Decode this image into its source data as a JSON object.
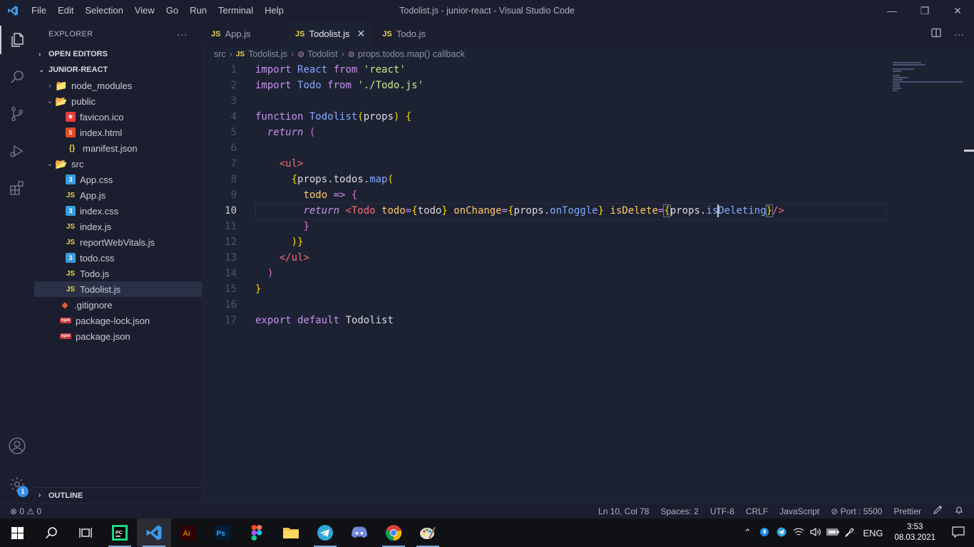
{
  "window": {
    "title": "Todolist.js - junior-react - Visual Studio Code",
    "menu": [
      "File",
      "Edit",
      "Selection",
      "View",
      "Go",
      "Run",
      "Terminal",
      "Help"
    ],
    "controls": {
      "minimize": "—",
      "restore": "❐",
      "close": "✕"
    }
  },
  "activity": {
    "settings_badge": "1"
  },
  "sidebar": {
    "header": "EXPLORER",
    "more": "···",
    "open_editors": "OPEN EDITORS",
    "project": "JUNIOR-REACT",
    "outline": "OUTLINE",
    "tree": [
      {
        "label": "node_modules",
        "type": "folder",
        "depth": 1,
        "chev": "›",
        "icon": "📁"
      },
      {
        "label": "public",
        "type": "folder",
        "depth": 1,
        "chev": "⌄",
        "icon": "📂"
      },
      {
        "label": "favicon.ico",
        "type": "ico",
        "depth": 2,
        "icon": "★"
      },
      {
        "label": "index.html",
        "type": "html",
        "depth": 2,
        "icon": "5"
      },
      {
        "label": "manifest.json",
        "type": "json",
        "depth": 2,
        "icon": "{}"
      },
      {
        "label": "src",
        "type": "folder",
        "depth": 1,
        "chev": "⌄",
        "icon": "📂"
      },
      {
        "label": "App.css",
        "type": "css",
        "depth": 2,
        "icon": "3"
      },
      {
        "label": "App.js",
        "type": "js",
        "depth": 2,
        "icon": "JS"
      },
      {
        "label": "index.css",
        "type": "css",
        "depth": 2,
        "icon": "3"
      },
      {
        "label": "index.js",
        "type": "js",
        "depth": 2,
        "icon": "JS"
      },
      {
        "label": "reportWebVitals.js",
        "type": "js",
        "depth": 2,
        "icon": "JS"
      },
      {
        "label": "todo.css",
        "type": "css",
        "depth": 2,
        "icon": "3"
      },
      {
        "label": "Todo.js",
        "type": "js",
        "depth": 2,
        "icon": "JS"
      },
      {
        "label": "Todolist.js",
        "type": "js",
        "depth": 2,
        "icon": "JS",
        "selected": true
      },
      {
        "label": ".gitignore",
        "type": "git",
        "depth": 1,
        "icon": "◆"
      },
      {
        "label": "package-lock.json",
        "type": "npm",
        "depth": 1,
        "icon": "npm"
      },
      {
        "label": "package.json",
        "type": "npm",
        "depth": 1,
        "icon": "npm"
      }
    ]
  },
  "tabs": [
    {
      "label": "App.js",
      "lang": "JS"
    },
    {
      "label": "Todolist.js",
      "lang": "JS",
      "active": true,
      "close": "✕"
    },
    {
      "label": "Todo.js",
      "lang": "JS"
    }
  ],
  "breadcrumb": {
    "folder": "src",
    "file_lang": "JS",
    "file": "Todolist.js",
    "symbol1": "Todolist",
    "symbol2": "props.todos.map() callback",
    "sep": "›",
    "symbol_icon": "⊚"
  },
  "code": {
    "current_line": 10,
    "lines": [
      "1",
      "2",
      "3",
      "4",
      "5",
      "6",
      "7",
      "8",
      "9",
      "10",
      "11",
      "12",
      "13",
      "14",
      "15",
      "16",
      "17"
    ]
  },
  "status": {
    "problems": "⊗ 0 ⚠ 0",
    "position": "Ln 10, Col 78",
    "spaces": "Spaces: 2",
    "encoding": "UTF-8",
    "eol": "CRLF",
    "language": "JavaScript",
    "port": "⊘ Port : 5500",
    "formatter": "Prettier"
  },
  "taskbar": {
    "lang": "ENG",
    "time": "3:53",
    "date": "08.03.2021"
  }
}
